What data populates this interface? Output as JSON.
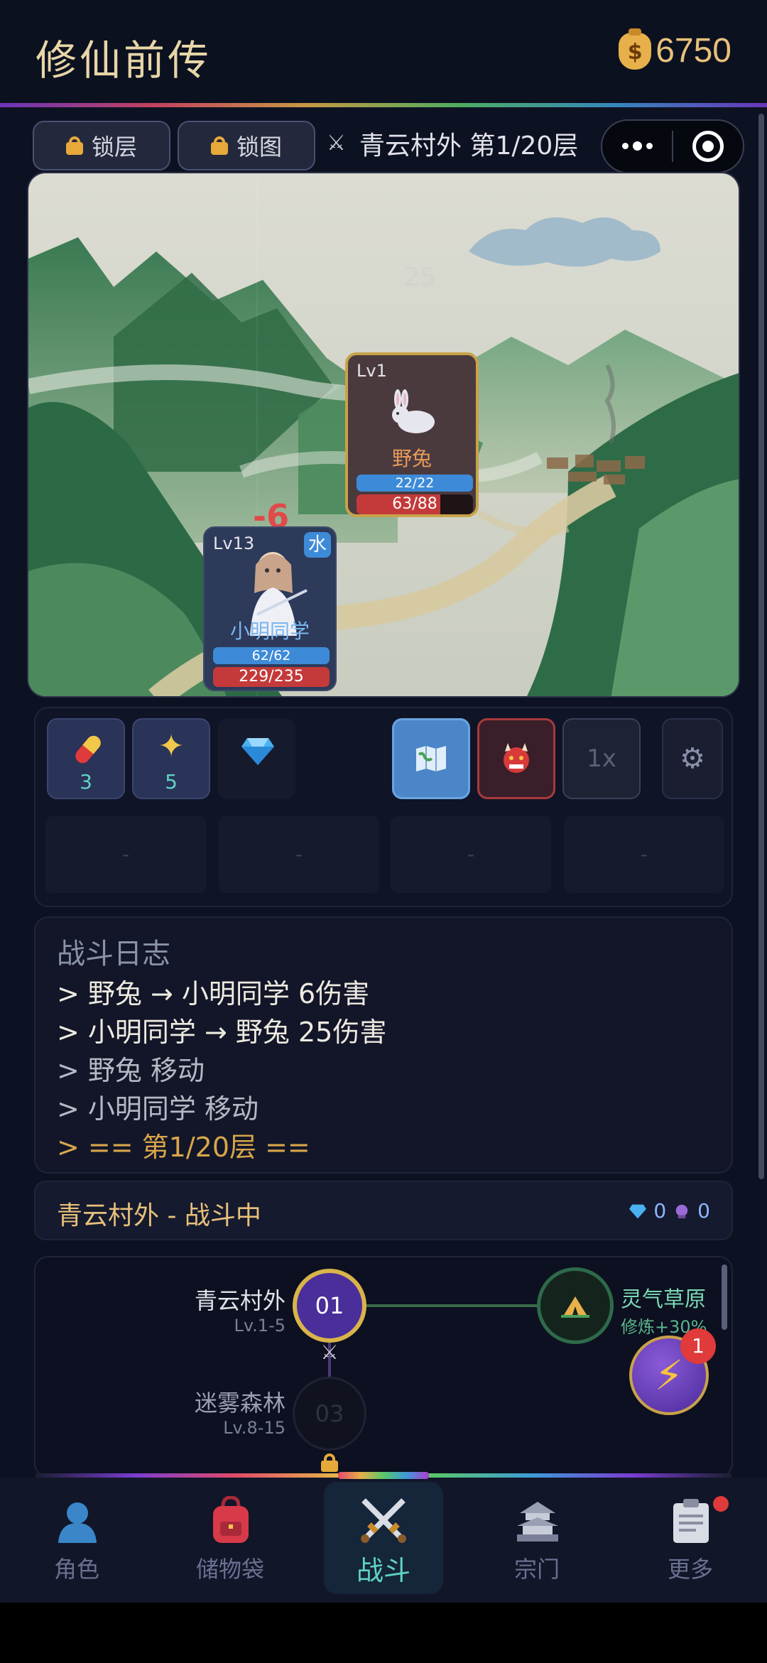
{
  "header": {
    "title": "修仙前传",
    "coins": "6750"
  },
  "topbar": {
    "lock_floor": "锁层",
    "lock_map": "锁图",
    "stage": "青云村外 第1/20层",
    "faded_number": "25"
  },
  "enemy": {
    "level": "Lv1",
    "name": "野兔",
    "mp": "22/22",
    "hp": "63/88",
    "hp_fraction": 0.716
  },
  "hero": {
    "level": "Lv13",
    "element": "水",
    "name": "小明同学",
    "mp": "62/62",
    "hp": "229/235",
    "damage_taken": "-6"
  },
  "items": [
    {
      "icon": "pill-icon",
      "count": "3"
    },
    {
      "icon": "sparkle-icon",
      "count": "5"
    },
    {
      "icon": "diamond-icon",
      "count": ""
    }
  ],
  "controls": {
    "speed": "1x"
  },
  "slots": [
    "-",
    "-",
    "-",
    "-"
  ],
  "battle_log": {
    "title": "战斗日志",
    "lines": [
      "> 野兔 → 小明同学 6伤害",
      "> 小明同学 → 野兔 25伤害",
      "> 野兔 移动",
      "> 小明同学 移动",
      "> == 第1/20层 =="
    ]
  },
  "status": {
    "text": "青云村外 - 战斗中",
    "gems": "0",
    "orbs": "0"
  },
  "map": {
    "nodes": [
      {
        "name": "青云村外",
        "range": "Lv.1-5",
        "number": "01"
      },
      {
        "name": "迷雾森林",
        "range": "Lv.8-15",
        "number": "03"
      }
    ],
    "side_node": {
      "name": "灵气草原",
      "bonus": "修炼+30%"
    }
  },
  "lightning_badge": "1",
  "nav": [
    {
      "label": "角色",
      "icon": "person-icon"
    },
    {
      "label": "储物袋",
      "icon": "backpack-icon"
    },
    {
      "label": "战斗",
      "icon": "crossed-swords-icon"
    },
    {
      "label": "宗门",
      "icon": "pagoda-icon"
    },
    {
      "label": "更多",
      "icon": "clipboard-icon"
    }
  ],
  "colors": {
    "accent_gold": "#e7c07a",
    "log_default": "#e6e3d8",
    "log_muted": "#b6b8c4",
    "log_highlight": "#d8a64a",
    "active_nav": "#5ed4c4"
  }
}
